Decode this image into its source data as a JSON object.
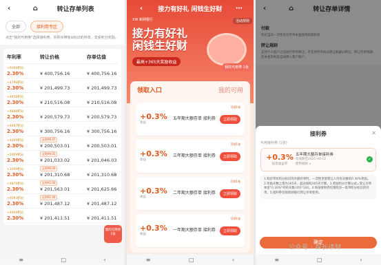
{
  "p1": {
    "title": "转让存单列表",
    "tab_all": "全部",
    "tab_coupon": "接利券专区",
    "note": "点击\"我的可用券\"选择接利券，并购买带有⊕标识的存单，享受积分奖励。",
    "headers": [
      "年利率",
      "转让价格",
      "存单估值"
    ],
    "rows": [
      {
        "pts": "+9469积分",
        "rate": "2.30%",
        "price": "¥ 400,756.16",
        "val": "¥ 400,756.16",
        "tag": ""
      },
      {
        "pts": "+4796积分",
        "rate": "2.30%",
        "price": "¥ 201,499.73",
        "val": "¥ 201,499.73",
        "tag": ""
      },
      {
        "pts": "+4958积分",
        "rate": "2.30%",
        "price": "¥ 210,516.08",
        "val": "¥ 210,516.08",
        "tag": ""
      },
      {
        "pts": "+4888积分",
        "rate": "2.30%",
        "price": "¥ 200,579.73",
        "val": "¥ 200,579.73",
        "tag": ""
      },
      {
        "pts": "+9497积分",
        "rate": "2.30%",
        "price": "¥ 300,756.16",
        "val": "¥ 300,756.16",
        "tag": ""
      },
      {
        "pts": "+4469积分",
        "rate": "2.30%",
        "price": "¥ 200,503.01",
        "val": "¥ 200,503.01",
        "tag": "让利¥9.37"
      },
      {
        "pts": "+5009积分",
        "rate": "2.30%",
        "price": "¥ 201,033.02",
        "val": "¥ 201,046.03",
        "tag": "让利¥9.01"
      },
      {
        "pts": "+3099积分",
        "rate": "2.30%",
        "price": "¥ 201,310.68",
        "val": "¥ 201,310.68",
        "tag": "让利¥9.00"
      },
      {
        "pts": "+4876积分",
        "rate": "2.30%",
        "price": "¥ 201,563.01",
        "val": "¥ 201,625.66",
        "tag": "让利¥2.00"
      },
      {
        "pts": "+9093积分",
        "rate": "2.30%",
        "price": "¥ 201,487.12",
        "val": "¥ 201,487.12",
        "tag": "让利¥1.00"
      },
      {
        "pts": "+4469积分",
        "rate": "2.30%",
        "price": "¥ 201,411.51",
        "val": "¥ 201,411.51",
        "tag": ""
      }
    ],
    "float_badge": "我的可用券 1张"
  },
  "p2": {
    "title": "接力有好礼 闲钱生好财",
    "brand": "XW 新网银行",
    "rules": "活动规则",
    "headline1": "接力有好礼",
    "headline2": "闲钱生好财",
    "sub": "最高+365天奖励收益",
    "bubble": "我的可用券 1张",
    "tab_left": "领取入口",
    "tab_right": "我的可用",
    "cards": [
      {
        "rate": "+0.3%",
        "unit": "收益",
        "name": "五年期大额存单 接利券",
        "btn": "立即领取",
        "tag": "可领1张"
      },
      {
        "rate": "+0.3%",
        "unit": "收益",
        "name": "三年期大额存单 接利券",
        "btn": "立即领取",
        "tag": "可领1张"
      },
      {
        "rate": "+0.3%",
        "unit": "收益",
        "name": "二年期大额存单 接利券",
        "btn": "立即领取",
        "tag": "可领1张"
      },
      {
        "rate": "+0.3%",
        "unit": "收益",
        "name": "一年期大额存单 接利券",
        "btn": "立即领取",
        "tag": "可领1张"
      }
    ]
  },
  "p3": {
    "title": "转让存单详情",
    "sec1": "付款",
    "sec1_text": "购买当日一次性支付存单本金及持有期利息",
    "sec2": "转让规则",
    "sec2_text": "支持个人客户之间进行存单转让，不支持存单拆分转让和部分转让。转让存单到期后本金及利息自动转入客户账户。",
    "sheet_title": "接利券",
    "avail": "可用接利券 (1张)",
    "coupon": {
      "rate": "+0.3%",
      "unit": "加息收益率",
      "name": "五年期大额存单接利券",
      "exp": "有效期至2025-04-22",
      "rule": "使用规则 ∧"
    },
    "desc": "1.购买带有积分标识的大额存单时，一次性享受转让人持有天数的0.30%奖励。2.奖励天数上限为365天，超过按照365天计算。3.奖励积分计算公式=受让存单本金*0.30%*持有天数/365*100。4.每张接利券仅限购买一笔带积分标识的存单。5.接利券仅限新网银行转让存单使用。",
    "ok": "确定",
    "watermark": "公众号 · 探长读财"
  },
  "nav": [
    "≡",
    "□",
    "‹"
  ]
}
